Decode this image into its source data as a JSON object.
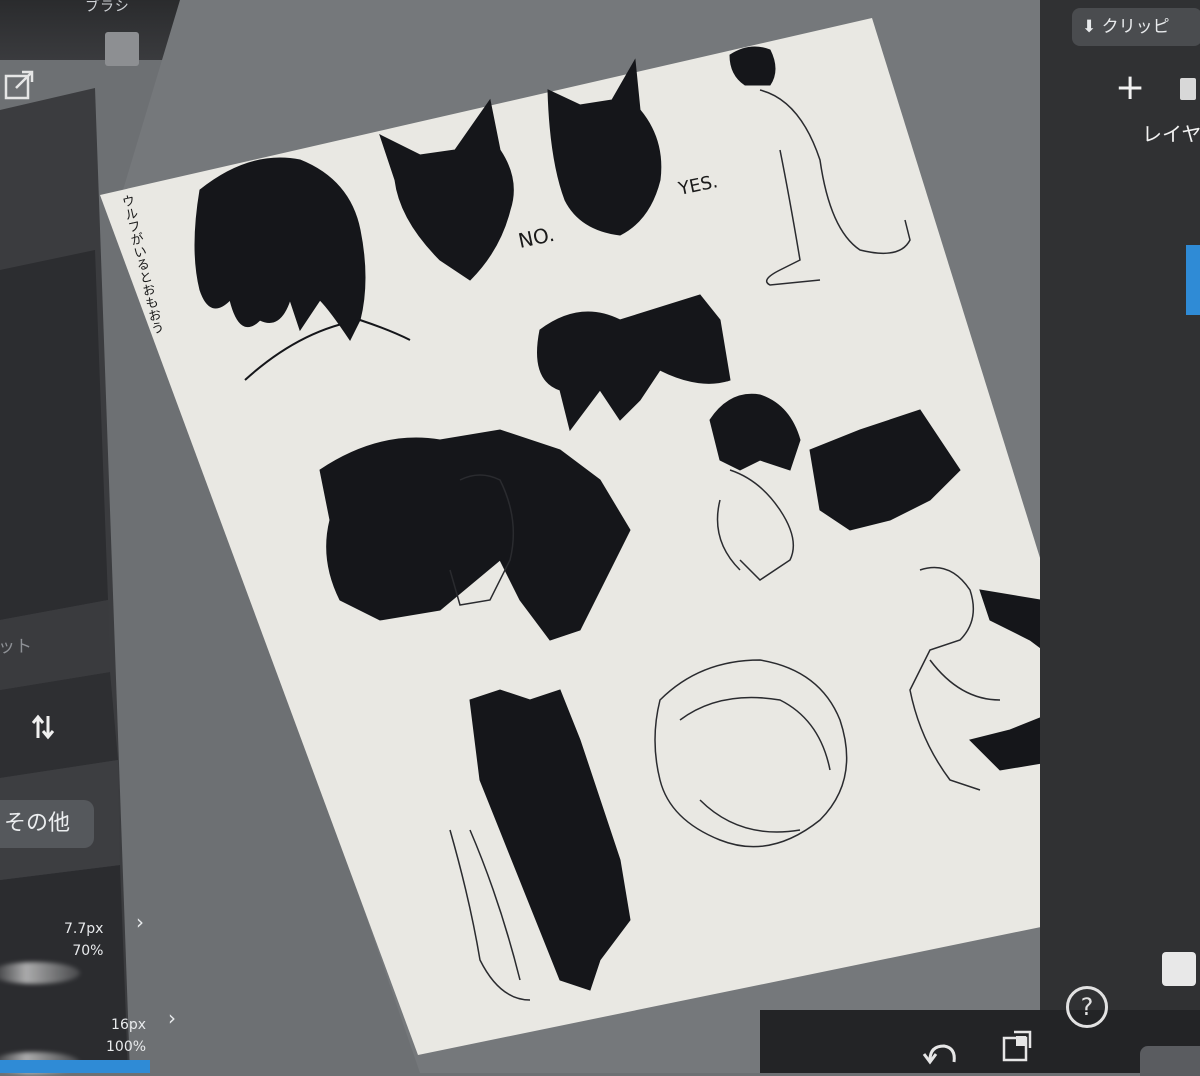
{
  "toolbar": {
    "brush_label": "ブラシ",
    "bucket_icon": "paint-bucket-icon",
    "export_icon": "export-icon"
  },
  "left_panel": {
    "preset_label": "ット",
    "other_button": "その他",
    "swap_icon": "swap-vertical-icon",
    "brushes": [
      {
        "size": "7.7px",
        "opacity": "70%"
      },
      {
        "size": "16px",
        "opacity": "100%"
      }
    ]
  },
  "right_panel": {
    "clip_button": "クリッピ",
    "add_icon": "plus-icon",
    "trash_icon": "trash-icon",
    "layer_label": "レイヤ"
  },
  "bottom_bar": {
    "undo_icon": "undo-icon",
    "eraser_icon": "eraser-icon",
    "help_icon": "help-icon",
    "help_glyph": "?",
    "share_icon": "share-icon"
  },
  "canvas": {
    "vertical_note": "ウルフがいるとおもおう",
    "label_no": "NO.",
    "label_yes": "YES.",
    "paper_color": "#e9e8e3",
    "ink_color": "#15161a"
  }
}
